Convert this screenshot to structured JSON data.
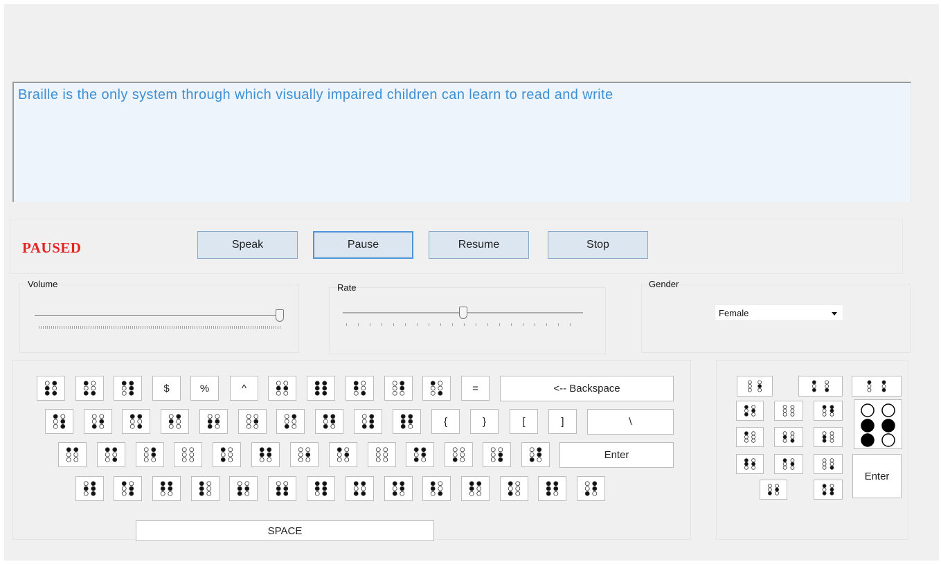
{
  "editor": {
    "text": "Braille is the only system through which visually impaired children can learn to read and write"
  },
  "status": {
    "text": "PAUSED",
    "color": "#e32424"
  },
  "buttons": {
    "speak": "Speak",
    "pause": "Pause",
    "resume": "Resume",
    "stop": "Stop"
  },
  "volume": {
    "label": "Volume",
    "value": 1.0
  },
  "rate": {
    "label": "Rate",
    "value": 0.5
  },
  "gender": {
    "label": "Gender",
    "value": "Female"
  },
  "keyboard": {
    "dollar": "$",
    "percent": "%",
    "caret": "^",
    "equals": "=",
    "backspace": "<--   Backspace",
    "lbrace": "{",
    "rbrace": "}",
    "lbracket": "[",
    "rbracket": "]",
    "backslash": "\\",
    "enter": "Enter",
    "space": "SPACE"
  },
  "numpad": {
    "enter": "Enter"
  }
}
